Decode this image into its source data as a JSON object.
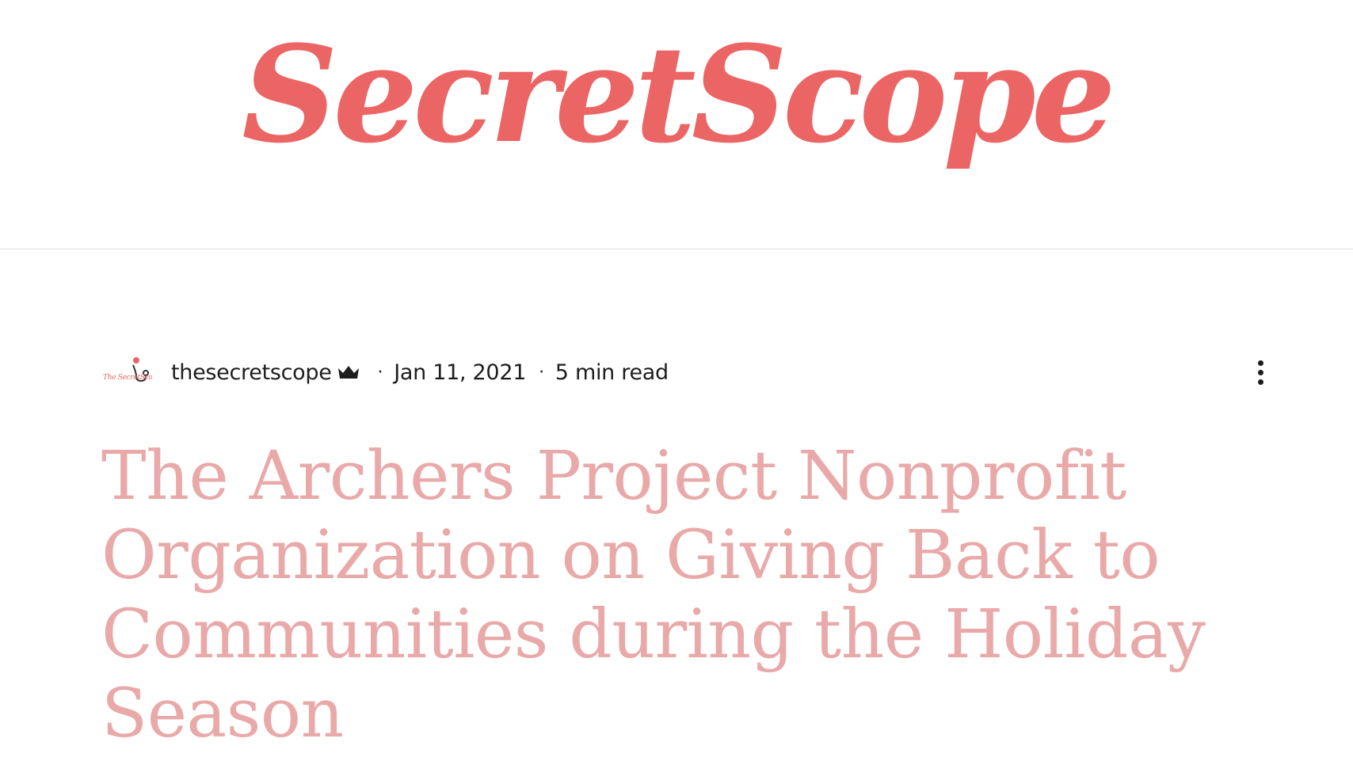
{
  "site": {
    "logo_text": "SecretScope",
    "logo_color": "#ec6565"
  },
  "post": {
    "author": "thesecretscope",
    "author_icon": "crown-icon",
    "separator": "·",
    "date": "Jan 11, 2021",
    "read_time": "5 min read",
    "title": "The Archers Project Nonprofit Organization on Giving Back to Communities during the Holiday Season",
    "title_color": "#e9a9a9",
    "avatar_text": "The SecretScope",
    "more_icon": "more-vertical-icon"
  }
}
